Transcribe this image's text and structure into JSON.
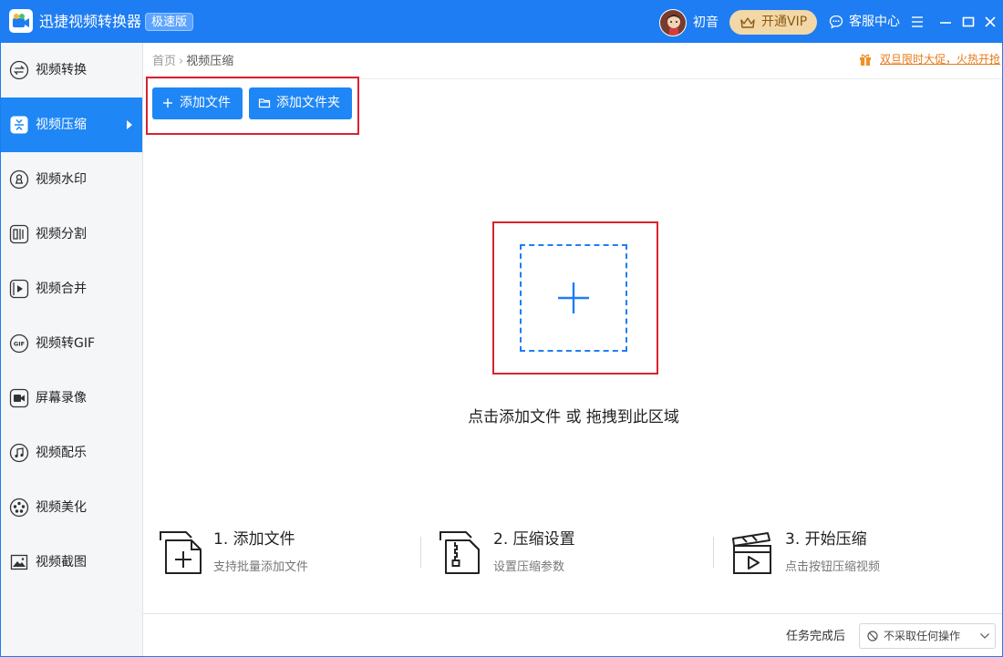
{
  "app": {
    "title": "迅捷视频转换器",
    "edition_badge": "极速版",
    "brand_color": "#1e7df2"
  },
  "header": {
    "username": "初音",
    "vip_label": "开通VIP",
    "support_label": "客服中心",
    "icons": [
      "menu-icon",
      "minimize-icon",
      "maximize-icon",
      "close-icon"
    ]
  },
  "sidebar": {
    "items": [
      {
        "label": "视频转换",
        "icon": "convert-icon"
      },
      {
        "label": "视频压缩",
        "icon": "compress-icon",
        "active": true
      },
      {
        "label": "视频水印",
        "icon": "watermark-icon"
      },
      {
        "label": "视频分割",
        "icon": "split-icon"
      },
      {
        "label": "视频合并",
        "icon": "merge-icon"
      },
      {
        "label": "视频转GIF",
        "icon": "gif-icon"
      },
      {
        "label": "屏幕录像",
        "icon": "record-icon"
      },
      {
        "label": "视频配乐",
        "icon": "music-icon"
      },
      {
        "label": "视频美化",
        "icon": "beautify-icon"
      },
      {
        "label": "视频截图",
        "icon": "screenshot-icon"
      }
    ]
  },
  "breadcrumb": {
    "home": "首页",
    "current": "视频压缩"
  },
  "promo": {
    "text": "双旦限时大促，火热开抢"
  },
  "toolbar": {
    "add_file": "添加文件",
    "add_folder": "添加文件夹"
  },
  "dropzone": {
    "hint": "点击添加文件 或 拖拽到此区域"
  },
  "steps": [
    {
      "title": "1. 添加文件",
      "desc": "支持批量添加文件"
    },
    {
      "title": "2. 压缩设置",
      "desc": "设置压缩参数"
    },
    {
      "title": "3. 开始压缩",
      "desc": "点击按钮压缩视频"
    }
  ],
  "footer": {
    "after_label": "任务完成后",
    "after_value": "不采取任何操作"
  }
}
